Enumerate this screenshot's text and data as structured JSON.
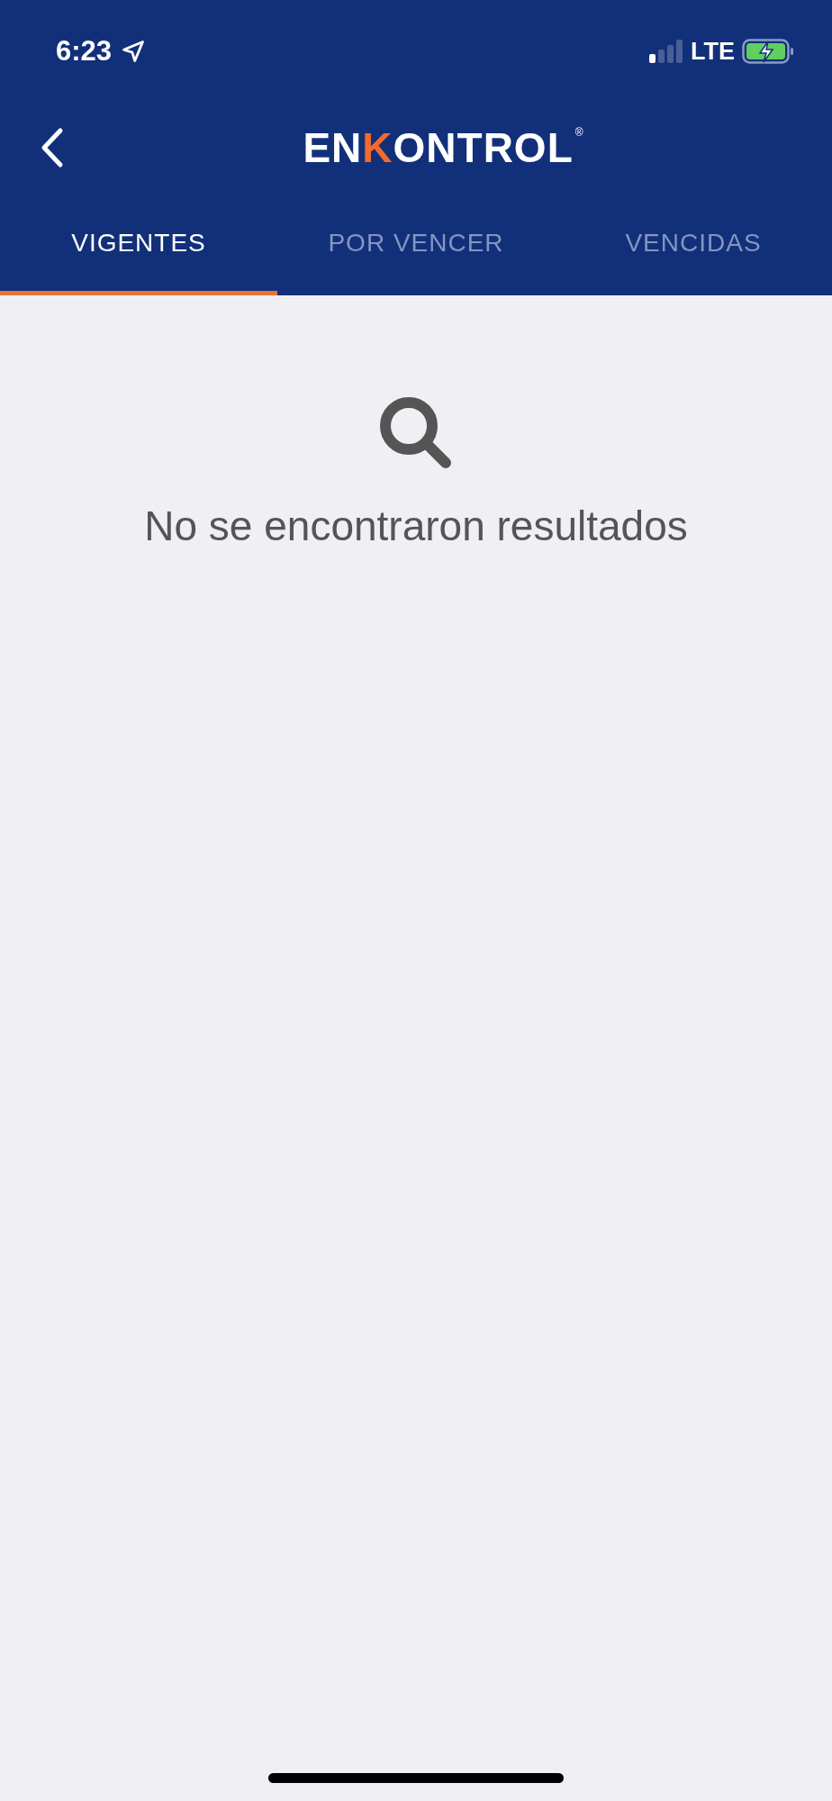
{
  "status_bar": {
    "time": "6:23",
    "network": "LTE"
  },
  "header": {
    "logo_parts": [
      {
        "text": "EN",
        "accent": false
      },
      {
        "text": "K",
        "accent": true
      },
      {
        "text": "ONTROL",
        "accent": false
      }
    ],
    "logo_mark": "®"
  },
  "tabs": [
    {
      "label": "VIGENTES",
      "selected": true
    },
    {
      "label": "POR VENCER",
      "selected": false
    },
    {
      "label": "VENCIDAS",
      "selected": false
    }
  ],
  "empty_state": {
    "message": "No se encontraron resultados"
  }
}
